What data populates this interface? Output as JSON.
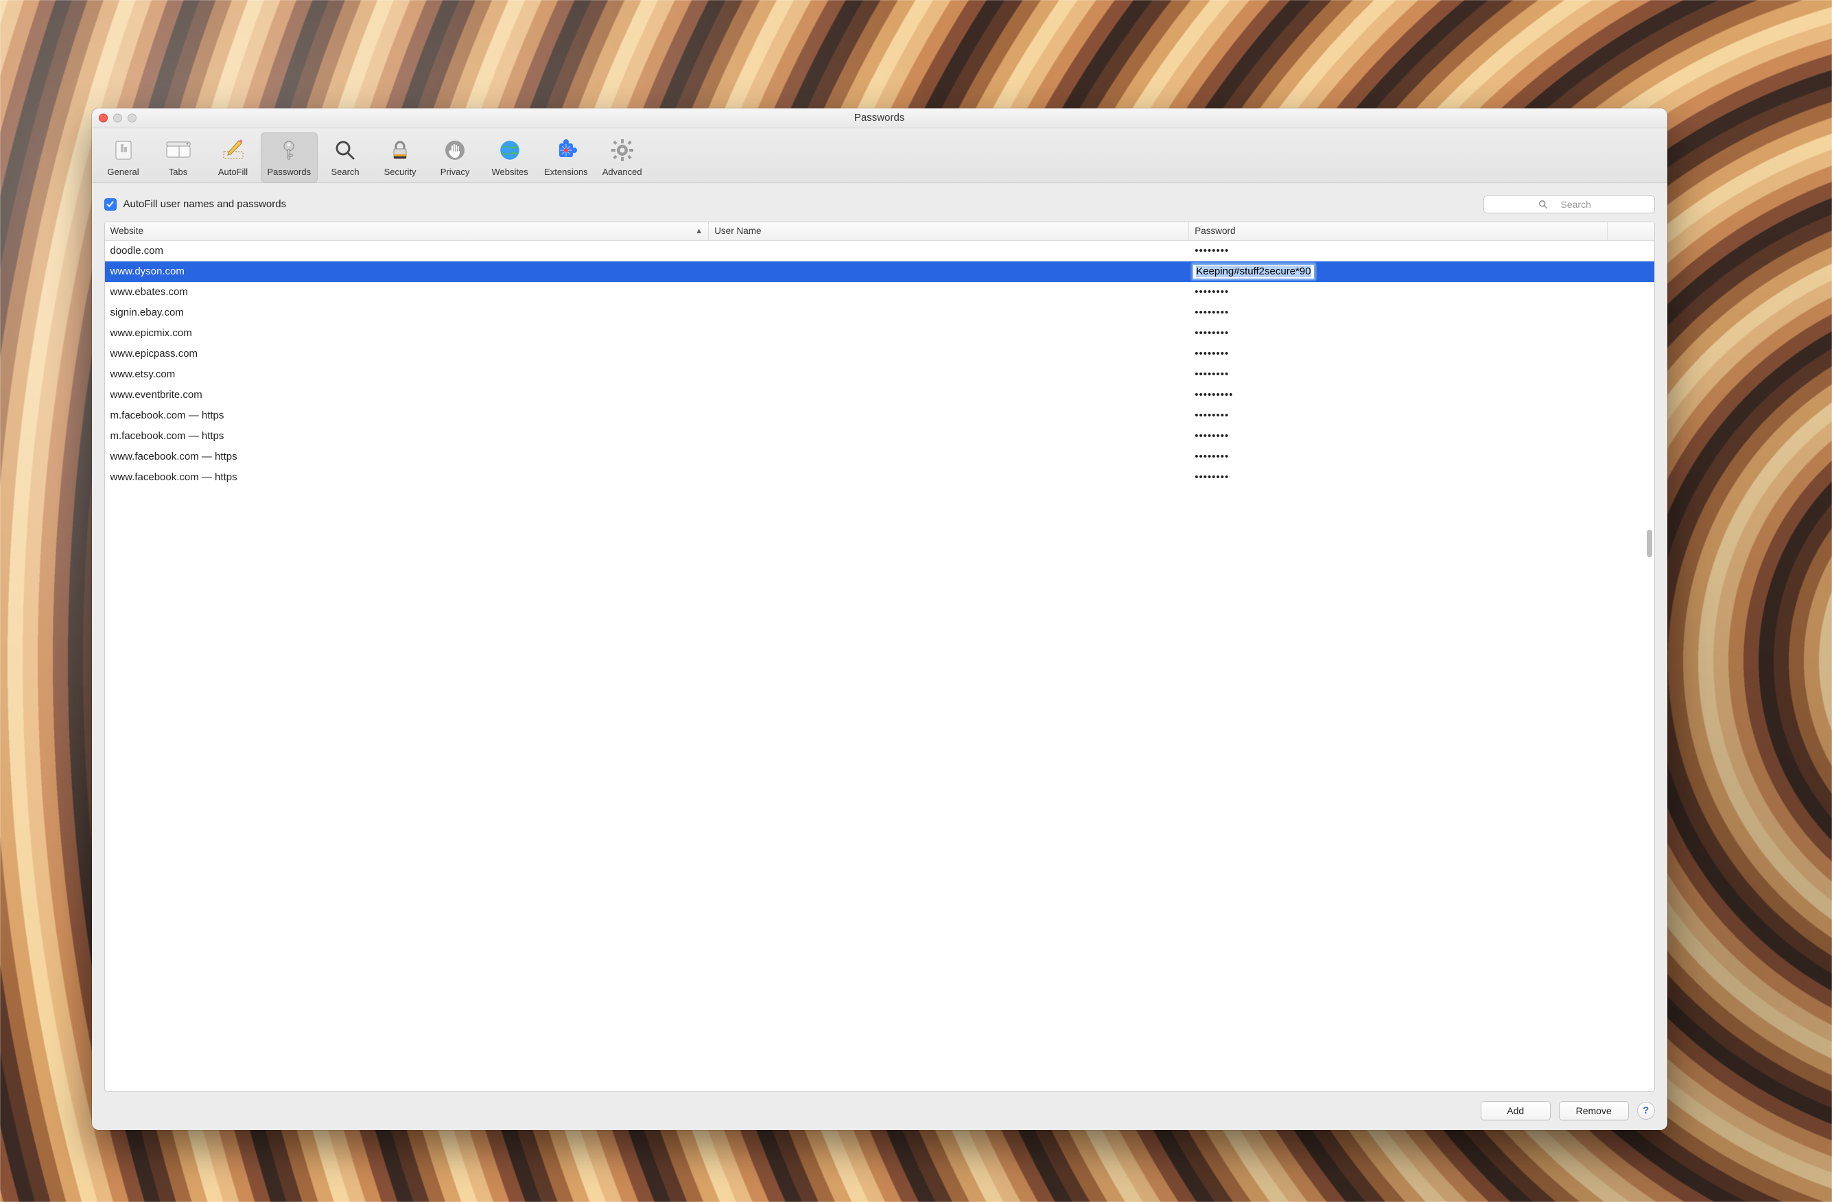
{
  "window": {
    "title": "Passwords"
  },
  "toolbar": {
    "items": [
      {
        "id": "general",
        "label": "General"
      },
      {
        "id": "tabs",
        "label": "Tabs"
      },
      {
        "id": "autofill",
        "label": "AutoFill"
      },
      {
        "id": "passwords",
        "label": "Passwords"
      },
      {
        "id": "search",
        "label": "Search"
      },
      {
        "id": "security",
        "label": "Security"
      },
      {
        "id": "privacy",
        "label": "Privacy"
      },
      {
        "id": "websites",
        "label": "Websites"
      },
      {
        "id": "extensions",
        "label": "Extensions"
      },
      {
        "id": "advanced",
        "label": "Advanced"
      }
    ],
    "active_id": "passwords"
  },
  "autofill_checkbox": {
    "checked": true,
    "label": "AutoFill user names and passwords"
  },
  "search": {
    "placeholder": "Search",
    "value": ""
  },
  "columns": {
    "website": "Website",
    "username": "User Name",
    "password": "Password",
    "sort_indicator": "▲"
  },
  "rows": [
    {
      "website": "doodle.com",
      "username": "",
      "password_masked": "••••••••"
    },
    {
      "website": "www.dyson.com",
      "username": "",
      "password_plaintext": "Keeping#stuff2secure*90",
      "selected": true
    },
    {
      "website": "www.ebates.com",
      "username": "",
      "password_masked": "••••••••"
    },
    {
      "website": "signin.ebay.com",
      "username": "",
      "password_masked": "••••••••"
    },
    {
      "website": "www.epicmix.com",
      "username": "",
      "password_masked": "••••••••"
    },
    {
      "website": "www.epicpass.com",
      "username": "",
      "password_masked": "••••••••"
    },
    {
      "website": "www.etsy.com",
      "username": "",
      "password_masked": "••••••••"
    },
    {
      "website": "www.eventbrite.com",
      "username": "",
      "password_masked": "•••••••••"
    },
    {
      "website": "m.facebook.com — https",
      "username": "",
      "password_masked": "••••••••"
    },
    {
      "website": "m.facebook.com — https",
      "username": "",
      "password_masked": "••••••••"
    },
    {
      "website": "www.facebook.com — https",
      "username": "",
      "password_masked": "••••••••"
    },
    {
      "website": "www.facebook.com — https",
      "username": "",
      "password_masked": "••••••••"
    }
  ],
  "buttons": {
    "add": "Add",
    "remove": "Remove",
    "help": "?"
  }
}
